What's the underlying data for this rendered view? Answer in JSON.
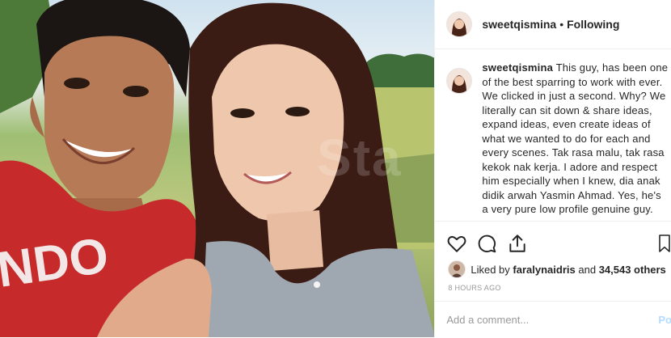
{
  "post": {
    "username": "sweetqismina",
    "separator": "•",
    "follow_status": "Following",
    "watermark": "Sta",
    "caption": {
      "username": "sweetqismina",
      "text": "This guy, has been one of the best sparring to work with ever. We clicked in just a second. Why? We literally can sit down & share ideas, expand ideas, even create ideas of what we wanted to do for each and every scenes. Tak rasa malu, tak rasa kekok nak kerja. I adore and respect him especially when I knew, dia anak didik arwah Yasmin Ahmad. Yes, he's a very pure low profile genuine guy."
    },
    "likes": {
      "prefix": "Liked by",
      "liker": "faralynaidris",
      "joiner": "and",
      "count": "34,543 others"
    },
    "timestamp": "8 HOURS AGO",
    "comment": {
      "placeholder": "Add a comment...",
      "post_label": "Po"
    },
    "icons": [
      "heart-icon",
      "comment-icon",
      "share-icon",
      "bookmark-icon"
    ],
    "colors": {
      "text": "#262626",
      "muted": "#999999",
      "border": "#efefef",
      "post_button": "#b3dbff"
    }
  }
}
